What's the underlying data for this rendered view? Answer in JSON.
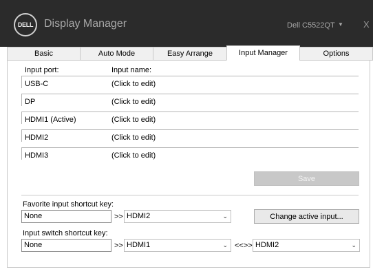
{
  "titlebar": {
    "logo_text": "DELL",
    "app_title": "Display Manager",
    "monitor_name": "Dell C5522QT",
    "close_label": "X"
  },
  "tabs": [
    {
      "label": "Basic"
    },
    {
      "label": "Auto Mode"
    },
    {
      "label": "Easy Arrange"
    },
    {
      "label": "Input Manager"
    },
    {
      "label": "Options"
    }
  ],
  "active_tab": "Input Manager",
  "input_manager": {
    "col_port": "Input port:",
    "col_name": "Input name:",
    "rows": [
      {
        "port": "USB-C",
        "name": "(Click to edit)"
      },
      {
        "port": "DP",
        "name": "(Click to edit)"
      },
      {
        "port": "HDMI1 (Active)",
        "name": "(Click to edit)"
      },
      {
        "port": "HDMI2",
        "name": "(Click to edit)"
      },
      {
        "port": "HDMI3",
        "name": "(Click to edit)"
      }
    ],
    "save_label": "Save"
  },
  "favorite": {
    "label": "Favorite input shortcut key:",
    "key_value": "None",
    "arrow": ">>",
    "input_value": "HDMI2",
    "change_button": "Change active input..."
  },
  "switch": {
    "label": "Input switch shortcut key:",
    "key_value": "None",
    "arrow": ">>",
    "input_a": "HDMI1",
    "between": "<<>>",
    "input_b": "HDMI2"
  }
}
